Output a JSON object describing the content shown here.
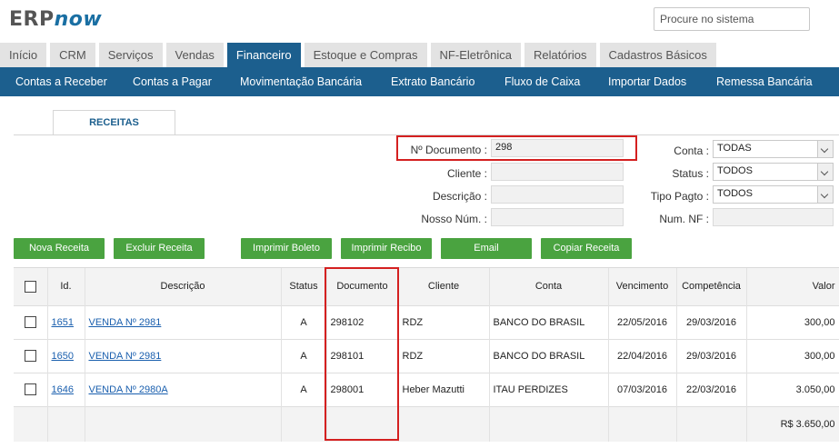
{
  "brand": {
    "erp": "ERP",
    "now": "now"
  },
  "search": {
    "placeholder": "Procure no sistema"
  },
  "tabs": [
    "Início",
    "CRM",
    "Serviços",
    "Vendas",
    "Financeiro",
    "Estoque e Compras",
    "NF-Eletrônica",
    "Relatórios",
    "Cadastros Básicos"
  ],
  "active_tab": "Financeiro",
  "subnav": [
    "Contas a Receber",
    "Contas a Pagar",
    "Movimentação Bancária",
    "Extrato Bancário",
    "Fluxo de Caixa",
    "Importar Dados",
    "Remessa Bancária"
  ],
  "inner_tab": "RECEITAS",
  "filters": {
    "documento_label": "Nº Documento :",
    "documento_value": "298",
    "cliente_label": "Cliente :",
    "descricao_label": "Descrição :",
    "nosso_label": "Nosso Núm. :",
    "conta_label": "Conta :",
    "conta_value": "TODAS",
    "status_label": "Status :",
    "status_value": "TODOS",
    "tipo_label": "Tipo Pagto :",
    "tipo_value": "TODOS",
    "numnf_label": "Num. NF :"
  },
  "buttons": {
    "nova": "Nova Receita",
    "excluir": "Excluir Receita",
    "boleto": "Imprimir Boleto",
    "recibo": "Imprimir Recibo",
    "email": "Email",
    "copiar": "Copiar Receita"
  },
  "table": {
    "headers": {
      "id": "Id.",
      "descricao": "Descrição",
      "status": "Status",
      "documento": "Documento",
      "cliente": "Cliente",
      "conta": "Conta",
      "vencimento": "Vencimento",
      "competencia": "Competência",
      "valor": "Valor"
    },
    "rows": [
      {
        "id": "1651",
        "descricao": "VENDA Nº 2981",
        "status": "A",
        "documento": "298102",
        "cliente": "RDZ",
        "conta": "BANCO DO BRASIL",
        "vencimento": "22/05/2016",
        "competencia": "29/03/2016",
        "valor": "300,00"
      },
      {
        "id": "1650",
        "descricao": "VENDA Nº 2981",
        "status": "A",
        "documento": "298101",
        "cliente": "RDZ",
        "conta": "BANCO DO BRASIL",
        "vencimento": "22/04/2016",
        "competencia": "29/03/2016",
        "valor": "300,00"
      },
      {
        "id": "1646",
        "descricao": "VENDA Nº 2980A",
        "status": "A",
        "documento": "298001",
        "cliente": "Heber Mazutti",
        "conta": "ITAU PERDIZES",
        "vencimento": "07/03/2016",
        "competencia": "22/03/2016",
        "valor": "3.050,00"
      }
    ],
    "total": "R$ 3.650,00"
  },
  "colors": {
    "nav": "#1c5f8e",
    "button": "#4aa340",
    "highlight": "#d42020",
    "link": "#1a5fae"
  }
}
